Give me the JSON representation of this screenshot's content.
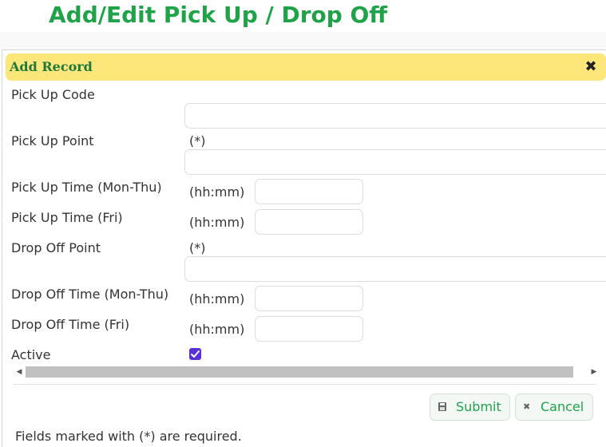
{
  "page": {
    "title": "Add/Edit Pick Up / Drop Off"
  },
  "dialog": {
    "title": "Add Record",
    "close_glyph": "✖",
    "fields": {
      "pickup_code": {
        "label": "Pick Up Code",
        "value": ""
      },
      "pickup_point": {
        "label": "Pick Up Point",
        "hint": "(*)",
        "value": ""
      },
      "pickup_time_monthu": {
        "label": "Pick Up Time (Mon-Thu)",
        "hint": "(hh:mm)",
        "value": ""
      },
      "pickup_time_fri": {
        "label": "Pick Up Time (Fri)",
        "hint": "(hh:mm)",
        "value": ""
      },
      "dropoff_point": {
        "label": "Drop Off Point",
        "hint": "(*)",
        "value": ""
      },
      "dropoff_time_monthu": {
        "label": "Drop Off Time (Mon-Thu)",
        "hint": "(hh:mm)",
        "value": ""
      },
      "dropoff_time_fri": {
        "label": "Drop Off Time (Fri)",
        "hint": "(hh:mm)",
        "value": ""
      },
      "active": {
        "label": "Active",
        "checked": true
      }
    },
    "buttons": {
      "submit_label": "Submit",
      "submit_icon": "save-icon",
      "cancel_label": "Cancel",
      "cancel_icon": "close-icon"
    },
    "footer_note": "Fields marked with (*) are required."
  },
  "colors": {
    "title_green": "#1fa348",
    "titlebar_yellow": "#fde67a",
    "checkbox_purple": "#5b2fd6"
  }
}
